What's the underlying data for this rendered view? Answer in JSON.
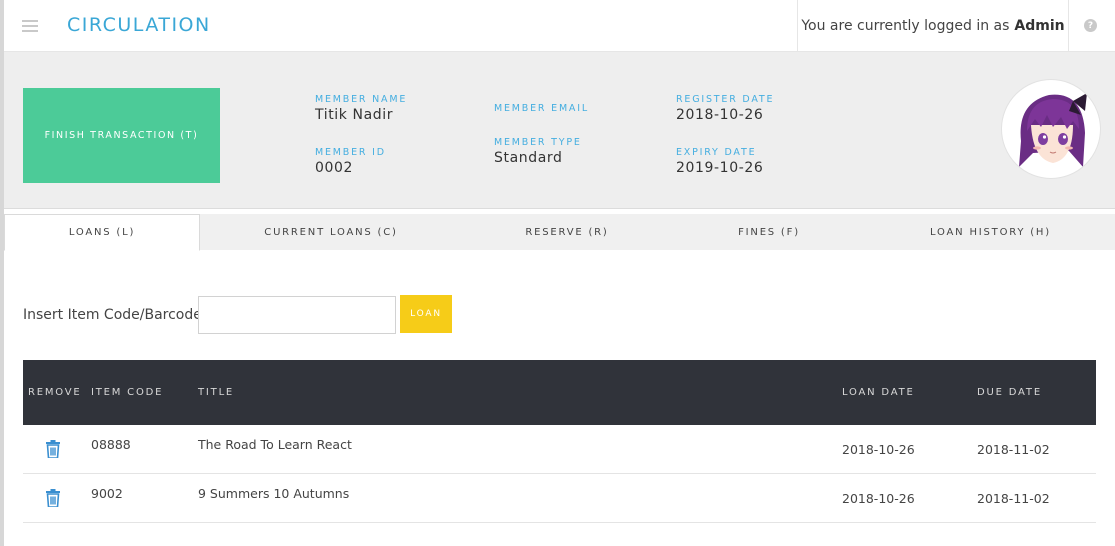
{
  "header": {
    "title": "CIRCULATION",
    "logged_in_text": "You are currently logged in as",
    "user": "Admin",
    "menu_icon": "hamburger-icon",
    "help_icon": "question-circle-icon",
    "help_glyph": "?"
  },
  "member": {
    "finish_button": "FINISH TRANSACTION (T)",
    "name_label": "MEMBER NAME",
    "name": "Titik Nadir",
    "id_label": "MEMBER ID",
    "id": "0002",
    "email_label": "MEMBER EMAIL",
    "email": "",
    "type_label": "MEMBER TYPE",
    "type": "Standard",
    "register_label": "REGISTER DATE",
    "register_date": "2018-10-26",
    "expiry_label": "EXPIRY DATE",
    "expiry_date": "2019-10-26",
    "avatar_icon": "member-avatar-image"
  },
  "tabs": [
    {
      "label": "LOANS (L)",
      "active": true
    },
    {
      "label": "CURRENT LOANS (C)",
      "active": false
    },
    {
      "label": "RESERVE (R)",
      "active": false
    },
    {
      "label": "FINES (F)",
      "active": false
    },
    {
      "label": "LOAN HISTORY (H)",
      "active": false
    }
  ],
  "loan_form": {
    "label": "Insert Item Code/Barcode :",
    "input_value": "",
    "button": "LOAN"
  },
  "table": {
    "headers": [
      "REMOVE",
      "ITEM CODE",
      "TITLE",
      "LOAN DATE",
      "DUE DATE"
    ],
    "rows": [
      {
        "item_code": "08888",
        "title": "The Road To Learn React",
        "loan_date": "2018-10-26",
        "due_date": "2018-11-02"
      },
      {
        "item_code": "9002",
        "title": "9 Summers 10 Autumns",
        "loan_date": "2018-10-26",
        "due_date": "2018-11-02"
      }
    ],
    "remove_icon": "trash-icon"
  },
  "colors": {
    "accent": "#3aa7d6",
    "finish_button": "#4ccb98",
    "loan_button": "#f6cc18",
    "table_header": "#30333a",
    "trash_icon": "#3a8fd0"
  }
}
